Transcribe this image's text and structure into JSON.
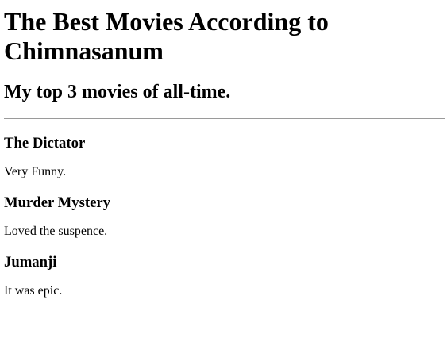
{
  "page": {
    "title": "The Best Movies According to Chimnasanum",
    "subtitle": "My top 3 movies of all-time."
  },
  "movies": [
    {
      "name": "The Dictator",
      "review": "Very Funny."
    },
    {
      "name": "Murder Mystery",
      "review": "Loved the suspence."
    },
    {
      "name": "Jumanji",
      "review": "It was epic."
    }
  ]
}
